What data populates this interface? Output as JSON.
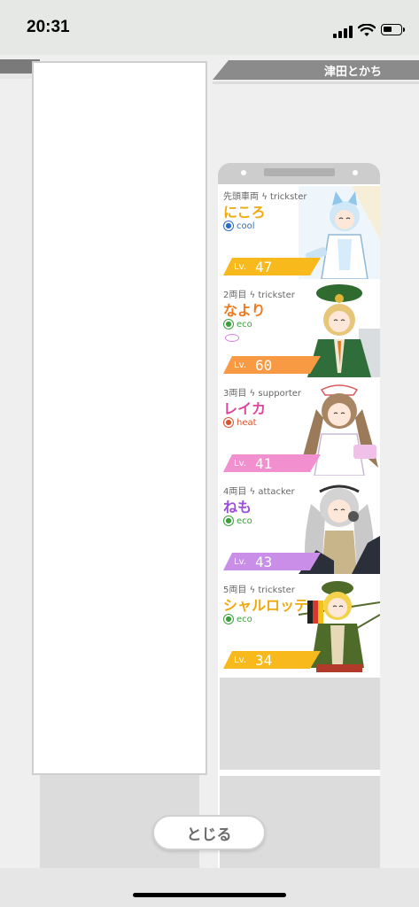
{
  "status_bar": {
    "time": "20:31"
  },
  "train": {
    "name": "津田とかち"
  },
  "cards": [
    {
      "position": "先頭車両",
      "role": "trickster",
      "name": "にころ",
      "name_color": "#f0a90f",
      "attribute": "cool",
      "attribute_color": "#2a6cbf",
      "level_label": "Lv.",
      "level": "47",
      "level_color": "#f7b91c"
    },
    {
      "position": "2両目",
      "role": "trickster",
      "name": "なより",
      "name_color": "#ef7a1e",
      "attribute": "eco",
      "attribute_color": "#3aa03a",
      "level_label": "Lv.",
      "level": "60",
      "level_color": "#f79a43"
    },
    {
      "position": "3両目",
      "role": "supporter",
      "name": "レイカ",
      "name_color": "#e0459e",
      "attribute": "heat",
      "attribute_color": "#d9542e",
      "level_label": "Lv.",
      "level": "41",
      "level_color": "#f28fcf"
    },
    {
      "position": "4両目",
      "role": "attacker",
      "name": "ねも",
      "name_color": "#9d4fd8",
      "attribute": "eco",
      "attribute_color": "#3aa03a",
      "level_label": "Lv.",
      "level": "43",
      "level_color": "#c98ee8"
    },
    {
      "position": "5両目",
      "role": "trickster",
      "name": "シャルロッテ",
      "name_color": "#f0a90f",
      "attribute": "eco",
      "attribute_color": "#3aa03a",
      "level_label": "Lv.",
      "level": "34",
      "level_color": "#f7b91c"
    }
  ],
  "footer": {
    "close_label": "とじる"
  },
  "icons": [
    "signal-icon",
    "wifi-icon",
    "battery-icon",
    "bolt-icon",
    "attribute-icon",
    "accessory-icon"
  ]
}
